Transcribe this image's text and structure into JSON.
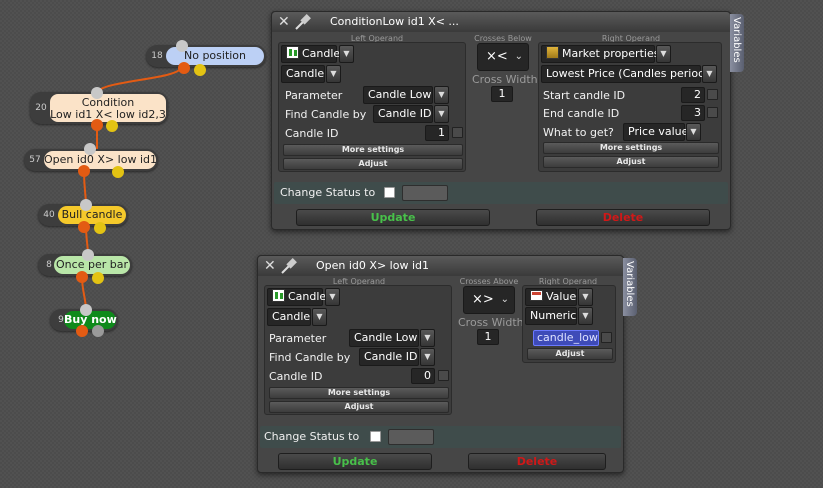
{
  "graph": {
    "nodes": [
      {
        "id": "no-position",
        "count": "18",
        "label": "No position",
        "color": "#bcd0f5"
      },
      {
        "id": "condition",
        "count": "20",
        "label": "Condition",
        "label2": "Low id1 X< low id2,3",
        "color": "#fbe3c8"
      },
      {
        "id": "open-cond",
        "count": "57",
        "label": "Open id0 X> low id1",
        "color": "#fbe3c8"
      },
      {
        "id": "bull-candle",
        "count": "40",
        "label": "Bull candle",
        "color": "#f5c92b"
      },
      {
        "id": "once-per-bar",
        "count": "8",
        "label": "Once per bar",
        "color": "#b9e6a8"
      },
      {
        "id": "buy-now",
        "count": "9",
        "label": "Buy now",
        "color": "#0e8a1b"
      }
    ]
  },
  "window1": {
    "title": "ConditionLow id1 X< ...",
    "variables_tab": "Variables",
    "left_head": "Left Operand",
    "mid_head": "Crosses Below",
    "right_head": "Right Operand",
    "left_type": "Candle",
    "left_sub": "Candle",
    "param_label": "Parameter",
    "param_value": "Candle Low",
    "find_label": "Find Candle by",
    "find_value": "Candle ID",
    "cid_label": "Candle ID",
    "cid_value": "1",
    "more_settings": "More settings",
    "adjust": "Adjust",
    "operator": "×<",
    "cross_width_label": "Cross Width",
    "cross_width": "1",
    "right_type": "Market properties",
    "right_sub": "Lowest Price (Candles period)",
    "start_label": "Start candle ID",
    "start_value": "2",
    "end_label": "End candle ID",
    "end_value": "3",
    "what_label": "What to get?",
    "what_value": "Price value",
    "more_settings_r": "More settings",
    "adjust_r": "Adjust",
    "status_label": "Change Status to",
    "update": "Update",
    "delete": "Delete"
  },
  "window2": {
    "title": "Open id0 X> low id1",
    "variables_tab": "Variables",
    "left_head": "Left Operand",
    "mid_head": "Crosses Above",
    "right_head": "Right Operand",
    "left_type": "Candle",
    "left_sub": "Candle",
    "param_label": "Parameter",
    "param_value": "Candle Low",
    "find_label": "Find Candle by",
    "find_value": "Candle ID",
    "cid_label": "Candle ID",
    "cid_value": "0",
    "more_settings": "More settings",
    "adjust": "Adjust",
    "operator": "×>",
    "cross_width_label": "Cross Width",
    "cross_width": "1",
    "right_type": "Value",
    "right_sub": "Numeric",
    "right_var": "candle_low",
    "adjust_r": "Adjust",
    "status_label": "Change Status to",
    "update": "Update",
    "delete": "Delete"
  }
}
